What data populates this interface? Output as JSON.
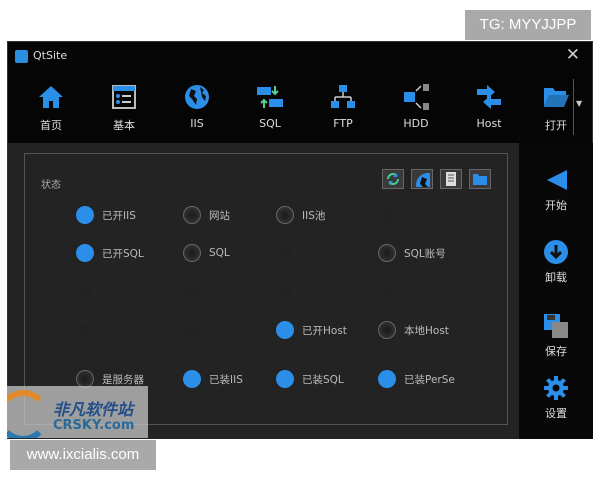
{
  "watermarks": {
    "tg": "TG: MYYJJPP",
    "url": "www.ixcialis.com",
    "logo_cn": "非凡软件站",
    "logo_en": "CRSKY.com"
  },
  "window": {
    "title": "QtSite",
    "close": "✕"
  },
  "toolbar": [
    {
      "label": "首页",
      "icon": "home-icon"
    },
    {
      "label": "基本",
      "icon": "list-icon"
    },
    {
      "label": "IIS",
      "icon": "globe-icon"
    },
    {
      "label": "SQL",
      "icon": "transfer-icon"
    },
    {
      "label": "FTP",
      "icon": "network-icon"
    },
    {
      "label": "HDD",
      "icon": "hdd-icon"
    },
    {
      "label": "Host",
      "icon": "arrows-icon"
    },
    {
      "label": "打开",
      "icon": "folder-open-icon"
    }
  ],
  "toolbar_more": "▼",
  "sidebar": [
    {
      "label": "开始",
      "icon": "play-left-icon"
    },
    {
      "label": "卸载",
      "icon": "download-icon"
    },
    {
      "label": "保存",
      "icon": "save-icon"
    },
    {
      "label": "设置",
      "icon": "gear-icon"
    }
  ],
  "status": {
    "title": "状态",
    "buttons": [
      "refresh-icon",
      "globe-icon",
      "document-icon",
      "folder-icon"
    ],
    "indicators": [
      {
        "label": "已开IIS",
        "on": true,
        "row": 0,
        "col": 0
      },
      {
        "label": "网站",
        "on": false,
        "row": 0,
        "col": 1
      },
      {
        "label": "IIS池",
        "on": false,
        "row": 0,
        "col": 2
      },
      {
        "label": "已开SQL",
        "on": true,
        "row": 1,
        "col": 0
      },
      {
        "label": "SQL",
        "on": false,
        "row": 1,
        "col": 1
      },
      {
        "label": "SQL账号",
        "on": false,
        "row": 1,
        "col": 3
      },
      {
        "label": "已开Host",
        "on": true,
        "row": 3,
        "col": 2
      },
      {
        "label": "本地Host",
        "on": false,
        "row": 3,
        "col": 3
      },
      {
        "label": "是服务器",
        "on": false,
        "row": 4,
        "col": 0
      },
      {
        "label": "已装IIS",
        "on": true,
        "row": 4,
        "col": 1
      },
      {
        "label": "已装SQL",
        "on": true,
        "row": 4,
        "col": 2
      },
      {
        "label": "已装PerSe",
        "on": true,
        "row": 4,
        "col": 3
      }
    ]
  },
  "colors": {
    "accent": "#2b8ee8",
    "panel": "#232323",
    "bg": "#050505"
  }
}
